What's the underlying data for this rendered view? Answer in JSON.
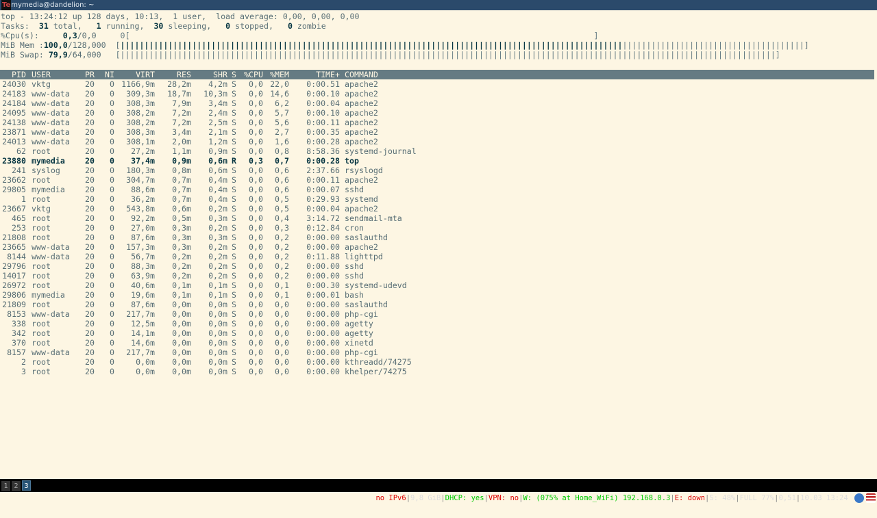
{
  "window": {
    "title": "mymedia@dandelion: ~",
    "title_prefix": "Te"
  },
  "header": {
    "line1": "top - 13:24:12 up 128 days, 10:13,  1 user,  load average: 0,00, 0,00, 0,00",
    "tasks_label": "Tasks:",
    "tasks_total": "31",
    "tasks_total_label": "total,",
    "tasks_running": "1",
    "tasks_running_label": "running,",
    "tasks_sleeping": "30",
    "tasks_sleeping_label": "sleeping,",
    "tasks_stopped": "0",
    "tasks_stopped_label": "stopped,",
    "tasks_zombie": "0",
    "tasks_zombie_label": "zombie",
    "cpu_label": "%Cpu(s):",
    "cpu_value": "0,3",
    "cpu_rest": "/0,0",
    "cpu_bar": "0[                                                                                                 ]",
    "mem_label": "MiB Mem :",
    "mem_used": "100,0",
    "mem_rest": "/128,000",
    "mem_bar_left": "[",
    "mem_bar_fill": "|||||||||||||||||||||||||||||||||||||||||||||||||||||||||||||||||||||||||||||||||||||||||||||||||||||||||",
    "mem_bar_rest": "||||||||||||||||||||||||||||||||||||||",
    "mem_bar_right": "]",
    "swap_label": "MiB Swap:",
    "swap_used": "79,9",
    "swap_rest": "/64,000",
    "swap_bar": "[|||||||||||||||||||||||||||||||||||||||||||||||||||||||||||||||||||||||||||||||||||||||||||||||||||||||||||||||||||||||||||||||||||||||||]"
  },
  "columns": [
    "PID",
    "USER",
    "PR",
    "NI",
    "VIRT",
    "RES",
    "SHR",
    "S",
    "%CPU",
    "%MEM",
    "TIME+",
    "COMMAND"
  ],
  "processes": [
    {
      "pid": "24030",
      "user": "vktg",
      "pr": "20",
      "ni": "0",
      "virt": "1166,9m",
      "res": "28,2m",
      "shr": "4,2m",
      "s": "S",
      "cpu": "0,0",
      "mem": "22,0",
      "time": "0:00.51",
      "cmd": "apache2"
    },
    {
      "pid": "24183",
      "user": "www-data",
      "pr": "20",
      "ni": "0",
      "virt": "309,3m",
      "res": "18,7m",
      "shr": "10,3m",
      "s": "S",
      "cpu": "0,0",
      "mem": "14,6",
      "time": "0:00.10",
      "cmd": "apache2"
    },
    {
      "pid": "24184",
      "user": "www-data",
      "pr": "20",
      "ni": "0",
      "virt": "308,3m",
      "res": "7,9m",
      "shr": "3,4m",
      "s": "S",
      "cpu": "0,0",
      "mem": "6,2",
      "time": "0:00.04",
      "cmd": "apache2"
    },
    {
      "pid": "24095",
      "user": "www-data",
      "pr": "20",
      "ni": "0",
      "virt": "308,2m",
      "res": "7,2m",
      "shr": "2,4m",
      "s": "S",
      "cpu": "0,0",
      "mem": "5,7",
      "time": "0:00.10",
      "cmd": "apache2"
    },
    {
      "pid": "24138",
      "user": "www-data",
      "pr": "20",
      "ni": "0",
      "virt": "308,2m",
      "res": "7,2m",
      "shr": "2,5m",
      "s": "S",
      "cpu": "0,0",
      "mem": "5,6",
      "time": "0:00.11",
      "cmd": "apache2"
    },
    {
      "pid": "23871",
      "user": "www-data",
      "pr": "20",
      "ni": "0",
      "virt": "308,3m",
      "res": "3,4m",
      "shr": "2,1m",
      "s": "S",
      "cpu": "0,0",
      "mem": "2,7",
      "time": "0:00.35",
      "cmd": "apache2"
    },
    {
      "pid": "24013",
      "user": "www-data",
      "pr": "20",
      "ni": "0",
      "virt": "308,1m",
      "res": "2,0m",
      "shr": "1,2m",
      "s": "S",
      "cpu": "0,0",
      "mem": "1,6",
      "time": "0:00.28",
      "cmd": "apache2"
    },
    {
      "pid": "62",
      "user": "root",
      "pr": "20",
      "ni": "0",
      "virt": "27,2m",
      "res": "1,1m",
      "shr": "0,9m",
      "s": "S",
      "cpu": "0,0",
      "mem": "0,8",
      "time": "8:58.36",
      "cmd": "systemd-journal"
    },
    {
      "pid": "23880",
      "user": "mymedia",
      "pr": "20",
      "ni": "0",
      "virt": "37,4m",
      "res": "0,9m",
      "shr": "0,6m",
      "s": "R",
      "cpu": "0,3",
      "mem": "0,7",
      "time": "0:00.28",
      "cmd": "top",
      "bold": true
    },
    {
      "pid": "241",
      "user": "syslog",
      "pr": "20",
      "ni": "0",
      "virt": "180,3m",
      "res": "0,8m",
      "shr": "0,6m",
      "s": "S",
      "cpu": "0,0",
      "mem": "0,6",
      "time": "2:37.66",
      "cmd": "rsyslogd"
    },
    {
      "pid": "23662",
      "user": "root",
      "pr": "20",
      "ni": "0",
      "virt": "304,7m",
      "res": "0,7m",
      "shr": "0,4m",
      "s": "S",
      "cpu": "0,0",
      "mem": "0,6",
      "time": "0:00.11",
      "cmd": "apache2"
    },
    {
      "pid": "29805",
      "user": "mymedia",
      "pr": "20",
      "ni": "0",
      "virt": "88,6m",
      "res": "0,7m",
      "shr": "0,4m",
      "s": "S",
      "cpu": "0,0",
      "mem": "0,6",
      "time": "0:00.07",
      "cmd": "sshd"
    },
    {
      "pid": "1",
      "user": "root",
      "pr": "20",
      "ni": "0",
      "virt": "36,2m",
      "res": "0,7m",
      "shr": "0,4m",
      "s": "S",
      "cpu": "0,0",
      "mem": "0,5",
      "time": "0:29.93",
      "cmd": "systemd"
    },
    {
      "pid": "23667",
      "user": "vktg",
      "pr": "20",
      "ni": "0",
      "virt": "543,8m",
      "res": "0,6m",
      "shr": "0,2m",
      "s": "S",
      "cpu": "0,0",
      "mem": "0,5",
      "time": "0:00.04",
      "cmd": "apache2"
    },
    {
      "pid": "465",
      "user": "root",
      "pr": "20",
      "ni": "0",
      "virt": "92,2m",
      "res": "0,5m",
      "shr": "0,3m",
      "s": "S",
      "cpu": "0,0",
      "mem": "0,4",
      "time": "3:14.72",
      "cmd": "sendmail-mta"
    },
    {
      "pid": "253",
      "user": "root",
      "pr": "20",
      "ni": "0",
      "virt": "27,0m",
      "res": "0,3m",
      "shr": "0,2m",
      "s": "S",
      "cpu": "0,0",
      "mem": "0,3",
      "time": "0:12.84",
      "cmd": "cron"
    },
    {
      "pid": "21808",
      "user": "root",
      "pr": "20",
      "ni": "0",
      "virt": "87,6m",
      "res": "0,3m",
      "shr": "0,3m",
      "s": "S",
      "cpu": "0,0",
      "mem": "0,2",
      "time": "0:00.00",
      "cmd": "saslauthd"
    },
    {
      "pid": "23665",
      "user": "www-data",
      "pr": "20",
      "ni": "0",
      "virt": "157,3m",
      "res": "0,3m",
      "shr": "0,2m",
      "s": "S",
      "cpu": "0,0",
      "mem": "0,2",
      "time": "0:00.00",
      "cmd": "apache2"
    },
    {
      "pid": "8144",
      "user": "www-data",
      "pr": "20",
      "ni": "0",
      "virt": "56,7m",
      "res": "0,2m",
      "shr": "0,2m",
      "s": "S",
      "cpu": "0,0",
      "mem": "0,2",
      "time": "0:11.88",
      "cmd": "lighttpd"
    },
    {
      "pid": "29796",
      "user": "root",
      "pr": "20",
      "ni": "0",
      "virt": "88,3m",
      "res": "0,2m",
      "shr": "0,2m",
      "s": "S",
      "cpu": "0,0",
      "mem": "0,2",
      "time": "0:00.00",
      "cmd": "sshd"
    },
    {
      "pid": "14017",
      "user": "root",
      "pr": "20",
      "ni": "0",
      "virt": "63,9m",
      "res": "0,2m",
      "shr": "0,2m",
      "s": "S",
      "cpu": "0,0",
      "mem": "0,2",
      "time": "0:00.00",
      "cmd": "sshd"
    },
    {
      "pid": "26972",
      "user": "root",
      "pr": "20",
      "ni": "0",
      "virt": "40,6m",
      "res": "0,1m",
      "shr": "0,1m",
      "s": "S",
      "cpu": "0,0",
      "mem": "0,1",
      "time": "0:00.30",
      "cmd": "systemd-udevd"
    },
    {
      "pid": "29806",
      "user": "mymedia",
      "pr": "20",
      "ni": "0",
      "virt": "19,6m",
      "res": "0,1m",
      "shr": "0,1m",
      "s": "S",
      "cpu": "0,0",
      "mem": "0,1",
      "time": "0:00.01",
      "cmd": "bash"
    },
    {
      "pid": "21809",
      "user": "root",
      "pr": "20",
      "ni": "0",
      "virt": "87,6m",
      "res": "0,0m",
      "shr": "0,0m",
      "s": "S",
      "cpu": "0,0",
      "mem": "0,0",
      "time": "0:00.00",
      "cmd": "saslauthd"
    },
    {
      "pid": "8153",
      "user": "www-data",
      "pr": "20",
      "ni": "0",
      "virt": "217,7m",
      "res": "0,0m",
      "shr": "0,0m",
      "s": "S",
      "cpu": "0,0",
      "mem": "0,0",
      "time": "0:00.00",
      "cmd": "php-cgi"
    },
    {
      "pid": "338",
      "user": "root",
      "pr": "20",
      "ni": "0",
      "virt": "12,5m",
      "res": "0,0m",
      "shr": "0,0m",
      "s": "S",
      "cpu": "0,0",
      "mem": "0,0",
      "time": "0:00.00",
      "cmd": "agetty"
    },
    {
      "pid": "342",
      "user": "root",
      "pr": "20",
      "ni": "0",
      "virt": "14,1m",
      "res": "0,0m",
      "shr": "0,0m",
      "s": "S",
      "cpu": "0,0",
      "mem": "0,0",
      "time": "0:00.00",
      "cmd": "agetty"
    },
    {
      "pid": "370",
      "user": "root",
      "pr": "20",
      "ni": "0",
      "virt": "14,6m",
      "res": "0,0m",
      "shr": "0,0m",
      "s": "S",
      "cpu": "0,0",
      "mem": "0,0",
      "time": "0:00.00",
      "cmd": "xinetd"
    },
    {
      "pid": "8157",
      "user": "www-data",
      "pr": "20",
      "ni": "0",
      "virt": "217,7m",
      "res": "0,0m",
      "shr": "0,0m",
      "s": "S",
      "cpu": "0,0",
      "mem": "0,0",
      "time": "0:00.00",
      "cmd": "php-cgi"
    },
    {
      "pid": "2",
      "user": "root",
      "pr": "20",
      "ni": "0",
      "virt": "0,0m",
      "res": "0,0m",
      "shr": "0,0m",
      "s": "S",
      "cpu": "0,0",
      "mem": "0,0",
      "time": "0:00.00",
      "cmd": "kthreadd/74275"
    },
    {
      "pid": "3",
      "user": "root",
      "pr": "20",
      "ni": "0",
      "virt": "0,0m",
      "res": "0,0m",
      "shr": "0,0m",
      "s": "S",
      "cpu": "0,0",
      "mem": "0,0",
      "time": "0:00.00",
      "cmd": "khelper/74275"
    }
  ],
  "statusbar": {
    "workspaces": [
      "1",
      "2",
      "3"
    ],
    "ipv6": "no IPv6",
    "disk": "9,8 GiB",
    "dhcp": "DHCP: yes",
    "vpn": "VPN: no",
    "wifi": "W: (075% at Home_WiFi) 192.168.0.3",
    "eth": "E: down",
    "swap": "S: 48%",
    "battery": "FULL 77%",
    "load": "0,51",
    "datetime": "10.03 13:24",
    "colors": {
      "red": "#dd0000",
      "green": "#00cc00"
    }
  }
}
